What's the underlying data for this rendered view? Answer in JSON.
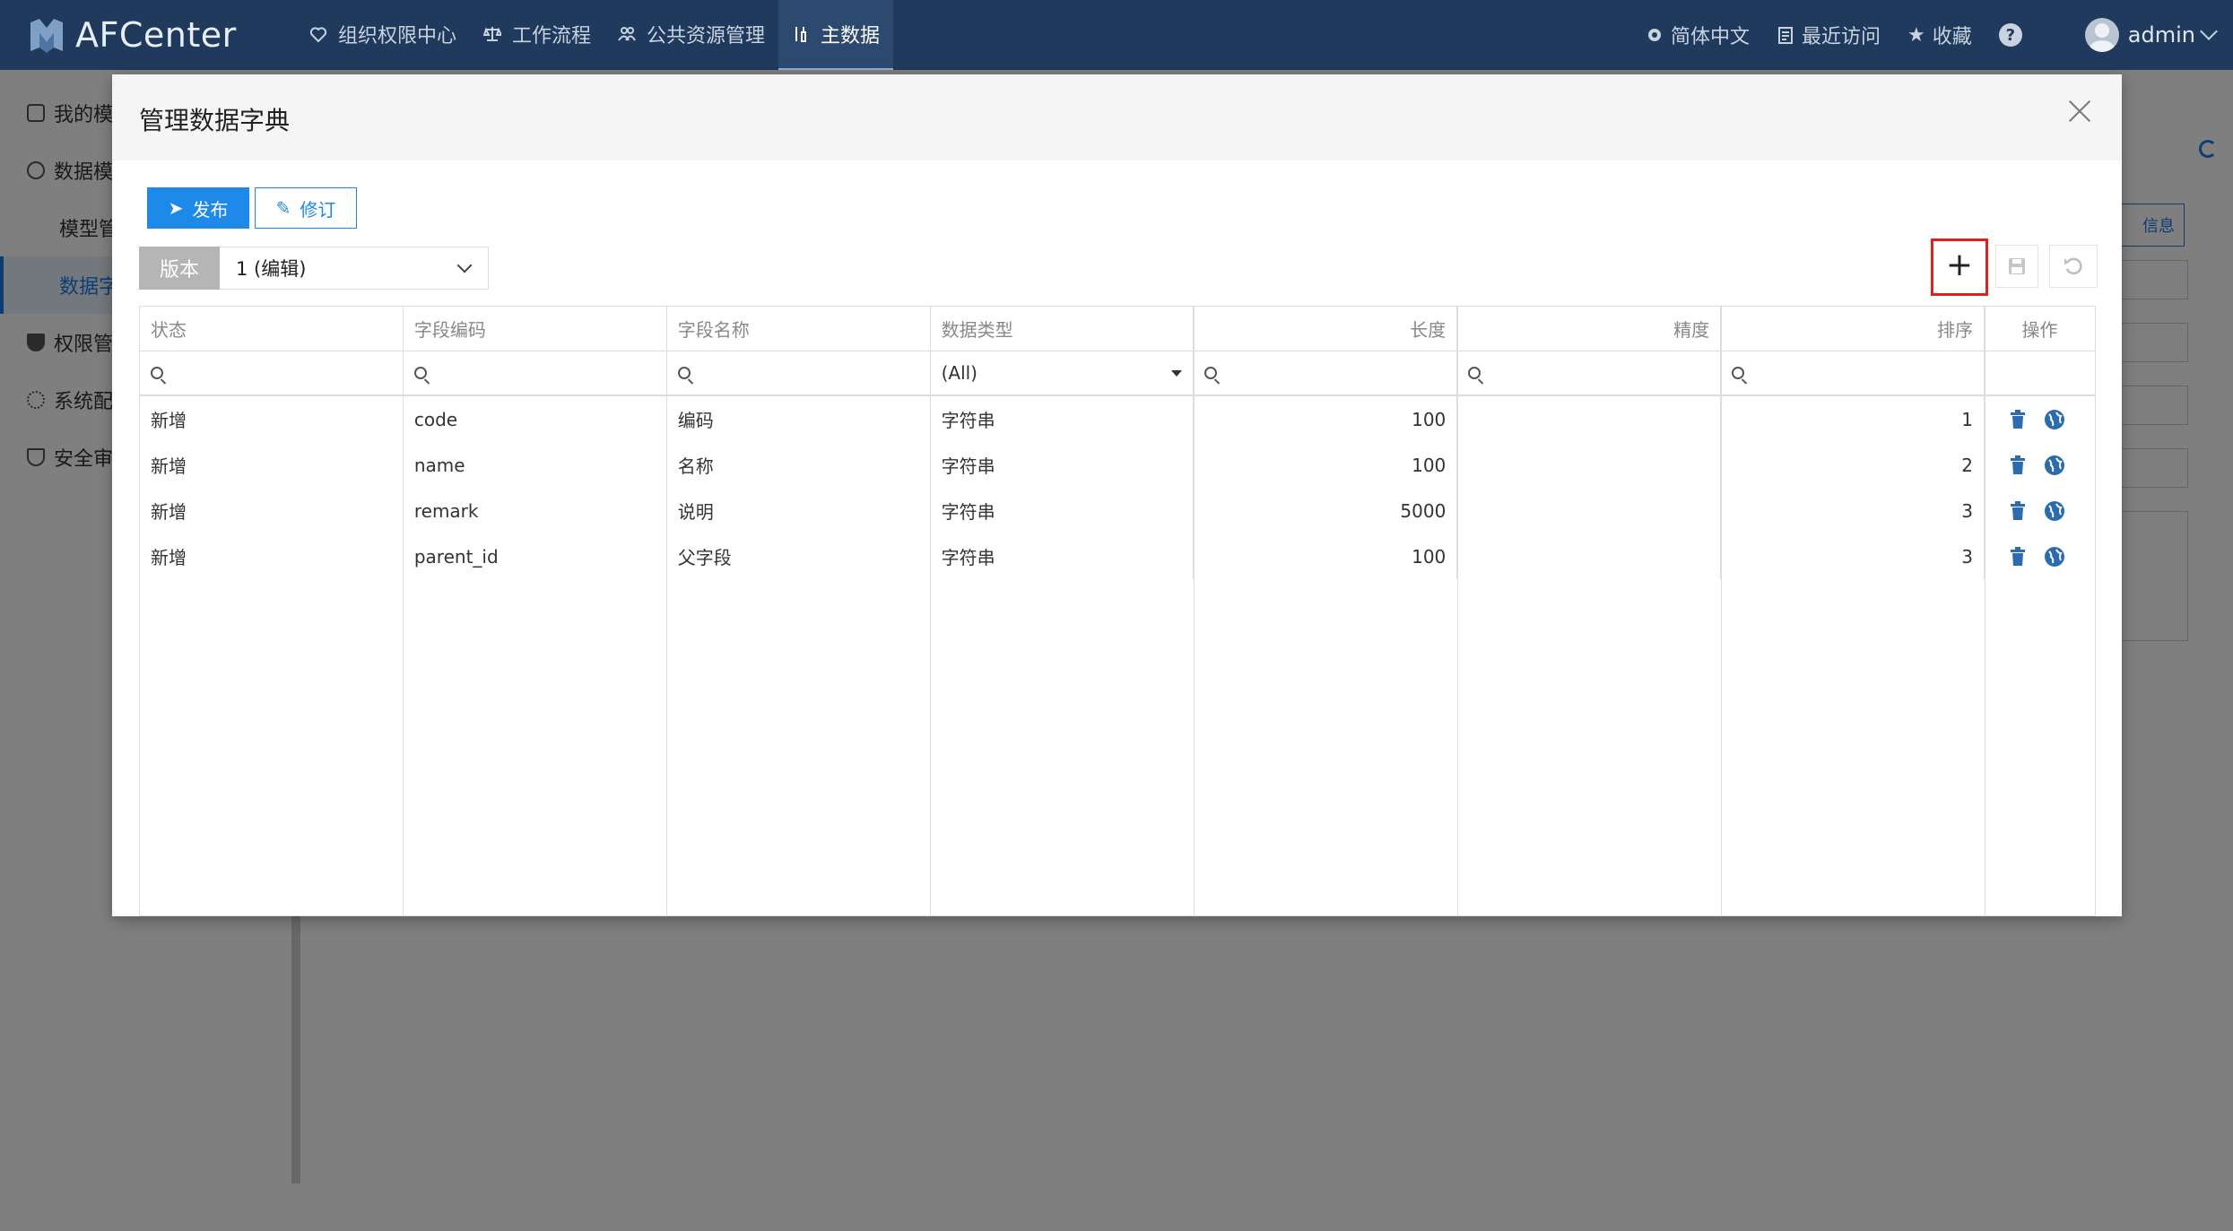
{
  "app": {
    "name": "AFCenter"
  },
  "nav": [
    {
      "label": "组织权限中心",
      "icon": "heart-shield-icon"
    },
    {
      "label": "工作流程",
      "icon": "scale-icon"
    },
    {
      "label": "公共资源管理",
      "icon": "users-icon"
    },
    {
      "label": "主数据",
      "icon": "tools-icon",
      "active": true
    }
  ],
  "header_tools": {
    "language": "简体中文",
    "recent": "最近访问",
    "favorites": "收藏",
    "help": "?",
    "user": "admin"
  },
  "sidebar": {
    "items": [
      {
        "label": "我的模",
        "icon": "folder-icon"
      },
      {
        "label": "数据模",
        "icon": "database-icon"
      },
      {
        "label": "模型管",
        "sub": true
      },
      {
        "label": "数据字",
        "sub": true,
        "active": true
      },
      {
        "label": "权限管",
        "icon": "shield-icon"
      },
      {
        "label": "系统配",
        "icon": "gear-icon"
      },
      {
        "label": "安全审",
        "icon": "security-icon"
      }
    ]
  },
  "background": {
    "info_button": "信息"
  },
  "modal": {
    "title": "管理数据字典",
    "publish_label": "发布",
    "revise_label": "修订",
    "version_label": "版本",
    "version_value": "1 (编辑)"
  },
  "grid": {
    "columns": [
      "状态",
      "字段编码",
      "字段名称",
      "数据类型",
      "长度",
      "精度",
      "排序",
      "操作"
    ],
    "type_filter": "(All)",
    "rows": [
      {
        "status": "新增",
        "code": "code",
        "name": "编码",
        "type": "字符串",
        "length": "100",
        "precision": "",
        "order": "1"
      },
      {
        "status": "新增",
        "code": "name",
        "name": "名称",
        "type": "字符串",
        "length": "100",
        "precision": "",
        "order": "2"
      },
      {
        "status": "新增",
        "code": "remark",
        "name": "说明",
        "type": "字符串",
        "length": "5000",
        "precision": "",
        "order": "3"
      },
      {
        "status": "新增",
        "code": "parent_id",
        "name": "父字段",
        "type": "字符串",
        "length": "100",
        "precision": "",
        "order": "3"
      }
    ]
  },
  "colors": {
    "topbar": "#1f3a5c",
    "primary": "#1d89e8",
    "highlight": "#e0201a",
    "action_icon": "#2b6cb0"
  }
}
